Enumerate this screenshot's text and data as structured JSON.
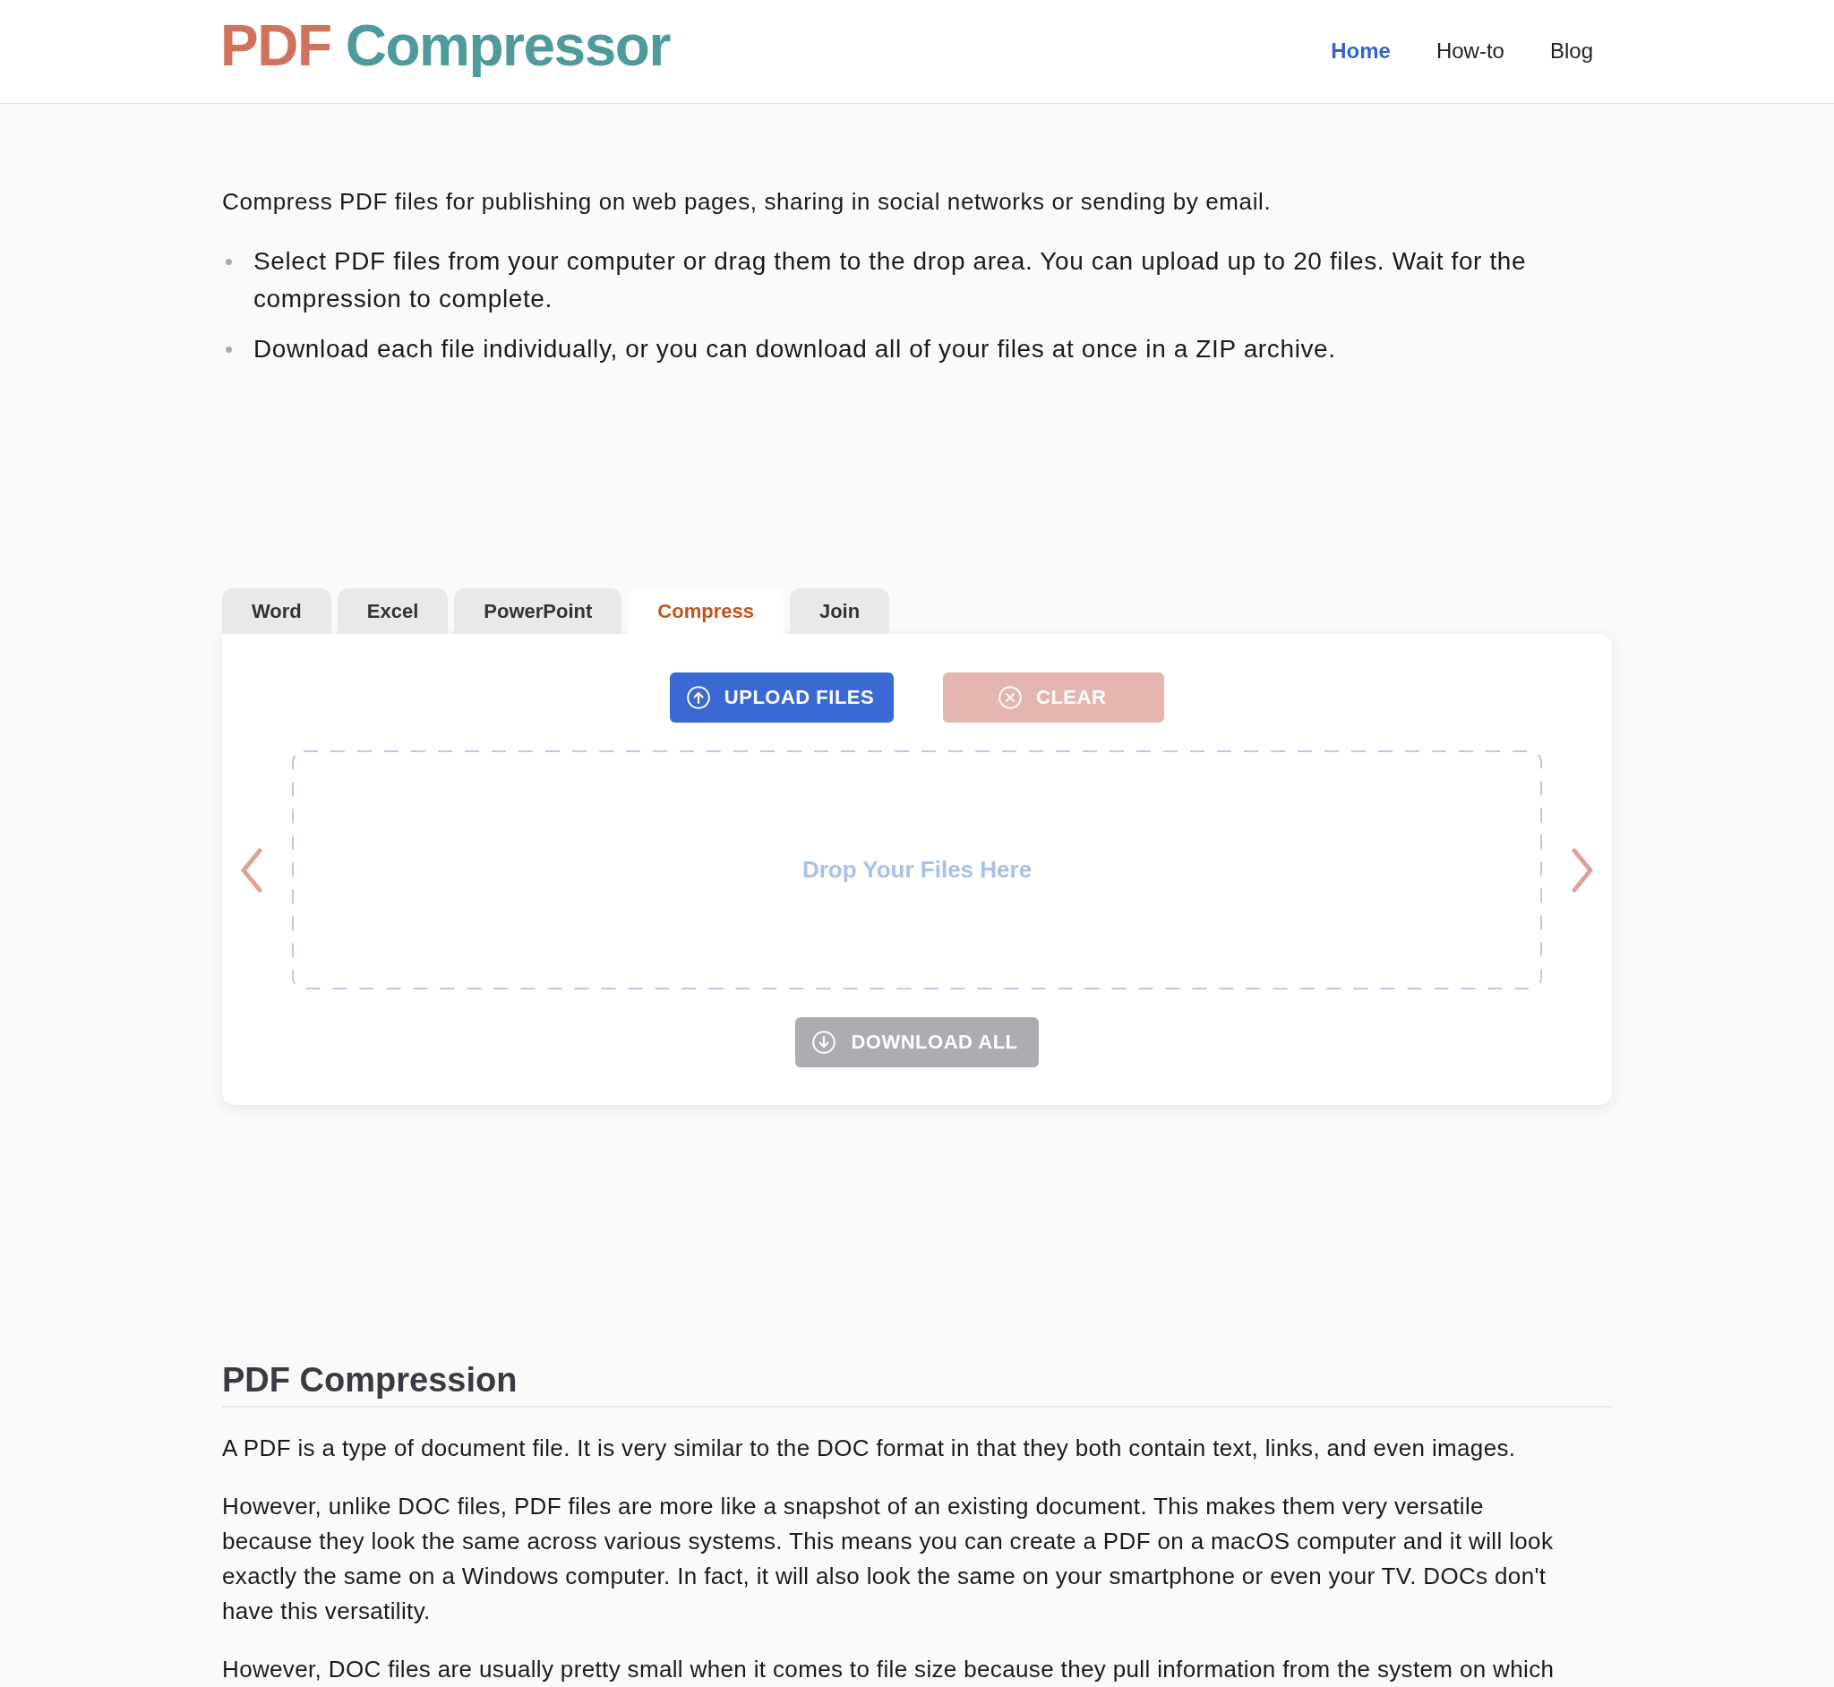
{
  "header": {
    "logo": "PDF Compressor",
    "nav": [
      {
        "label": "Home",
        "selected": true
      },
      {
        "label": "How-to",
        "selected": false
      },
      {
        "label": "Blog",
        "selected": false
      }
    ]
  },
  "intro": {
    "text": "Compress PDF files for publishing on web pages, sharing in social networks or sending by email.",
    "steps": [
      "Select PDF files from your computer or drag them to the drop area. You can upload up to 20 files. Wait for the compression to complete.",
      "Download each file individually, or you can download all of your files at once in a ZIP archive."
    ]
  },
  "converter": {
    "tabs": [
      {
        "label": "Word",
        "selected": false
      },
      {
        "label": "Excel",
        "selected": false
      },
      {
        "label": "PowerPoint",
        "selected": false
      },
      {
        "label": "Compress",
        "selected": true
      },
      {
        "label": "Join",
        "selected": false
      }
    ],
    "actions": [
      {
        "kind": "upload",
        "label": "UPLOAD FILES",
        "disabled": false
      },
      {
        "kind": "clear",
        "label": "CLEAR",
        "disabled": true
      }
    ],
    "drop_zone": {
      "placeholder": "Drop Your Files Here"
    },
    "download": {
      "kind": "download",
      "label": "DOWNLOAD ALL",
      "disabled": true
    }
  },
  "article": {
    "heading": "PDF Compression",
    "paragraphs": [
      "A PDF is a type of document file. It is very similar to the DOC format in that they both contain text, links, and even images.",
      "However, unlike DOC files, PDF files are more like a snapshot of an existing document. This makes them very versatile because they look the same across various systems. This means you can create a PDF on a macOS computer and it will look exactly the same on a Windows computer. In fact, it will also look the same on your smartphone or even your TV. DOCs don't have this versatility.",
      "However, DOC files are usually pretty small when it comes to file size because they pull information from the system on which"
    ]
  }
}
